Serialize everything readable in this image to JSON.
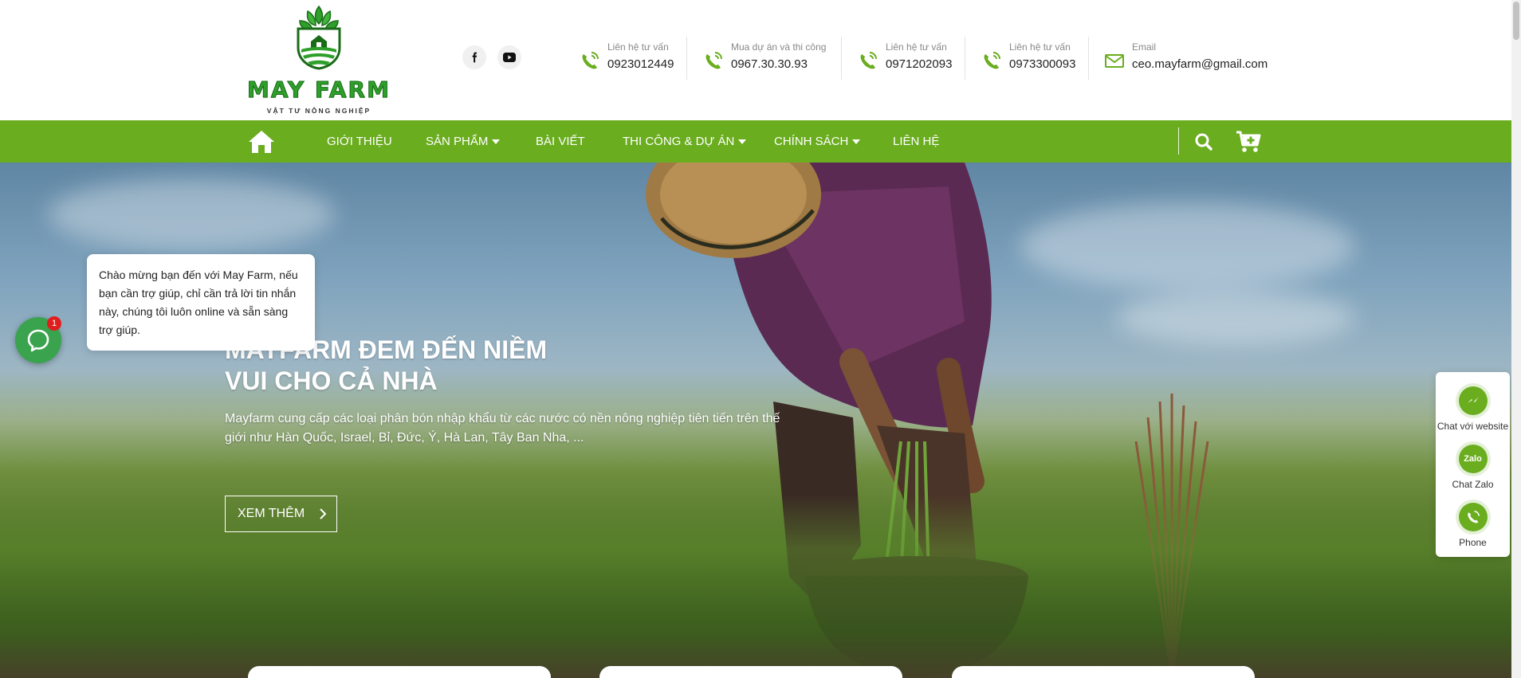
{
  "header": {
    "logo": {
      "title": "MAY FARM",
      "subtitle": "VẬT TƯ NÔNG NGHIỆP"
    },
    "social": [
      "facebook-icon",
      "youtube-icon"
    ],
    "contacts": [
      {
        "label": "Liên hệ tư vấn",
        "value": "0923012449"
      },
      {
        "label": "Mua dự án và thi công",
        "value": "0967.30.30.93"
      },
      {
        "label": "Liên hệ tư vấn",
        "value": "0971202093"
      },
      {
        "label": "Liên hệ tư vấn",
        "value": "0973300093"
      },
      {
        "label": "Email",
        "value": "ceo.mayfarm@gmail.com"
      }
    ]
  },
  "nav": {
    "items": [
      {
        "label": "GIỚI THIỆU"
      },
      {
        "label": "SẢN PHẨM"
      },
      {
        "label": "BÀI VIẾT"
      },
      {
        "label": "THI CÔNG & DỰ ÁN"
      },
      {
        "label": "CHÍNH SÁCH"
      },
      {
        "label": "LIÊN HỆ"
      }
    ]
  },
  "hero": {
    "title": "MAYFARM ĐEM ĐẾN NIỀM VUI CHO CẢ NHÀ",
    "description": "Mayfarm cung cấp các loại phân bón nhập khẩu từ các nước có nền nông nghiệp tiên tiến trên thế giới như Hàn Quốc, Israel, Bỉ, Đức, Ý, Hà Lan, Tây Ban Nha, ...",
    "button": "XEM THÊM"
  },
  "chat_widget": {
    "message": "Chào mừng bạn đến với May Farm, nếu bạn cần trợ giúp, chỉ cần trả lời tin nhắn này, chúng tôi luôn online và sẵn sàng trợ giúp.",
    "badge": "1"
  },
  "floating": {
    "items": [
      {
        "label": "Chat với website"
      },
      {
        "label": "Chat Zalo",
        "icon_text": "Zalo"
      },
      {
        "label": "Phone"
      }
    ]
  },
  "colors": {
    "brand_green": "#6aad1f",
    "logo_green": "#2e9f2a"
  }
}
